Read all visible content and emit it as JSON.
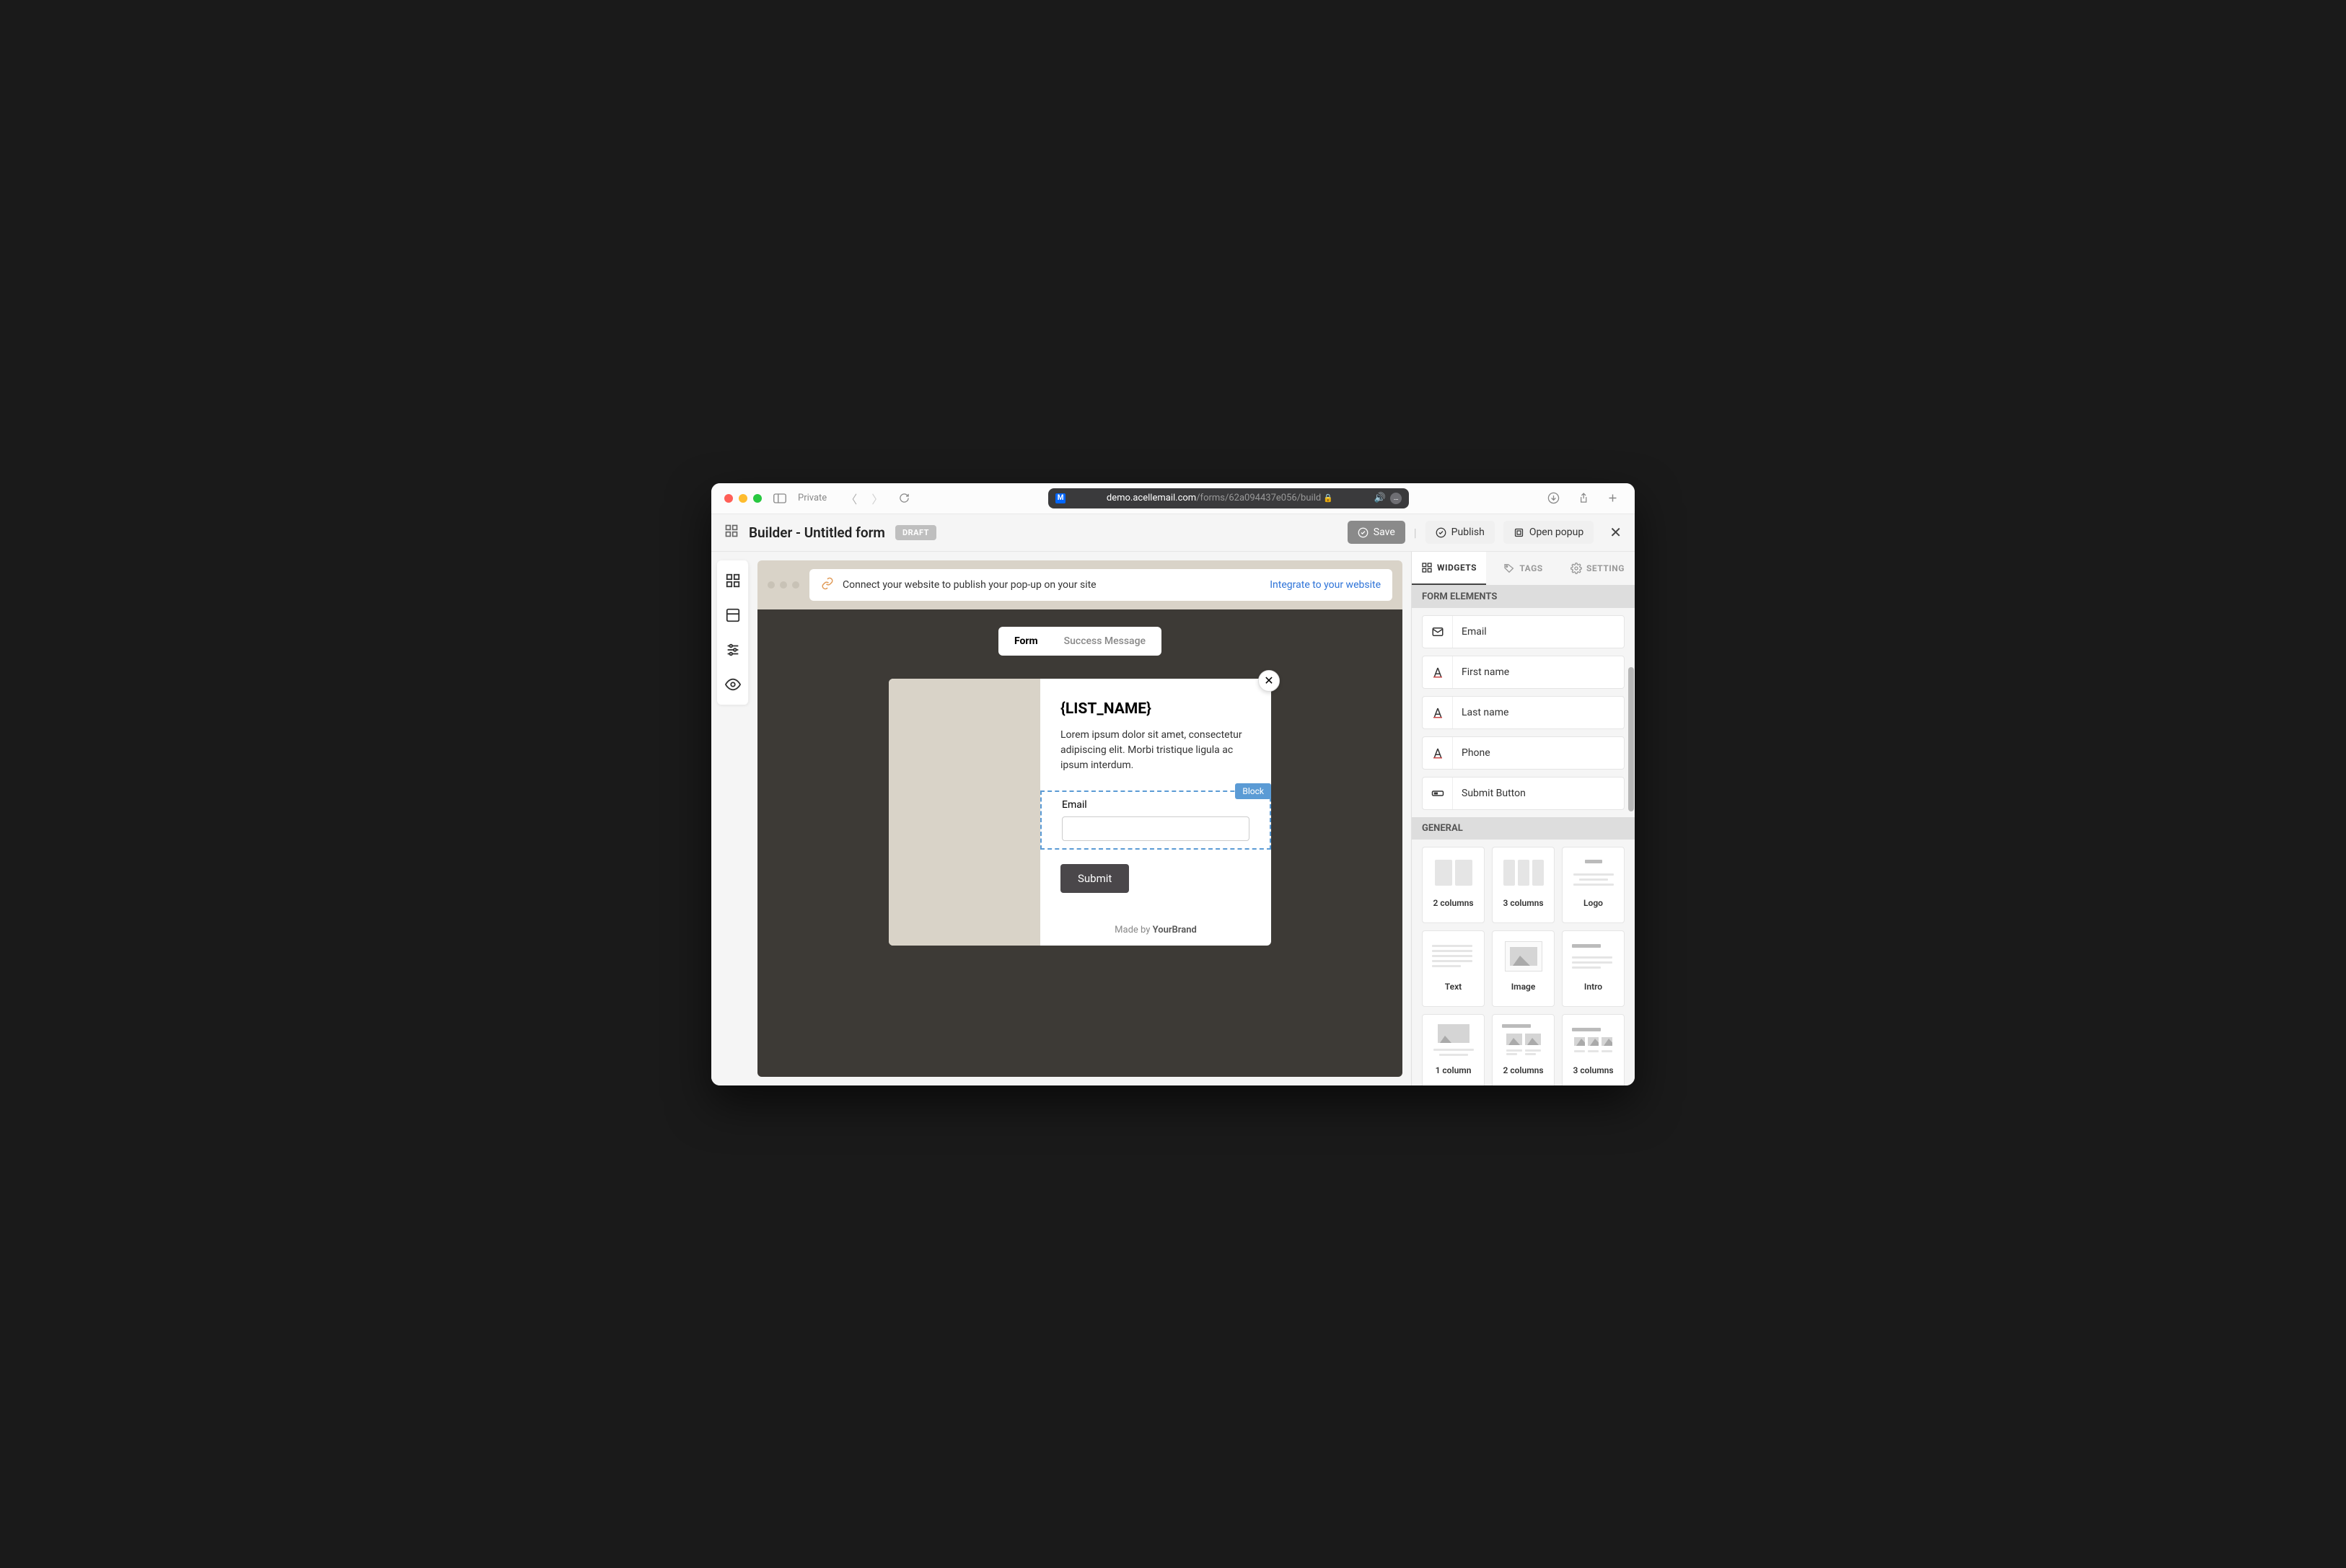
{
  "browser": {
    "private_label": "Private",
    "url_domain": "demo.acellemail.com",
    "url_path": "/forms/62a094437e056/build"
  },
  "header": {
    "title": "Builder - Untitled form",
    "draft_badge": "DRAFT",
    "save_label": "Save",
    "publish_label": "Publish",
    "open_popup_label": "Open popup"
  },
  "canvas": {
    "integrate_text": "Connect your website to publish your pop-up on your site",
    "integrate_link": "Integrate to your website",
    "tabs": {
      "form": "Form",
      "success": "Success Message"
    },
    "popup": {
      "title": "{LIST_NAME}",
      "description": "Lorem ipsum dolor sit amet, consectetur adipiscing elit. Morbi tristique ligula ac ipsum interdum.",
      "block_badge": "Block",
      "email_label": "Email",
      "submit_label": "Submit",
      "footer_text": "Made by ",
      "footer_brand": "YourBrand"
    }
  },
  "panel": {
    "tabs": {
      "widgets": "WIDGETS",
      "tags": "TAGS",
      "setting": "SETTING"
    },
    "form_elements_title": "FORM ELEMENTS",
    "form_elements": [
      {
        "label": "Email",
        "icon": "mail"
      },
      {
        "label": "First name",
        "icon": "text"
      },
      {
        "label": "Last name",
        "icon": "text"
      },
      {
        "label": "Phone",
        "icon": "text"
      },
      {
        "label": "Submit Button",
        "icon": "button"
      }
    ],
    "general_title": "GENERAL",
    "general": [
      {
        "label": "2 columns",
        "type": "2col"
      },
      {
        "label": "3 columns",
        "type": "3col"
      },
      {
        "label": "Logo",
        "type": "logo"
      },
      {
        "label": "Text",
        "type": "text"
      },
      {
        "label": "Image",
        "type": "image"
      },
      {
        "label": "Intro",
        "type": "intro"
      },
      {
        "label": "1 column",
        "type": "1col"
      },
      {
        "label": "2 columns",
        "type": "2colimg"
      },
      {
        "label": "3 columns",
        "type": "3colimg"
      }
    ]
  }
}
